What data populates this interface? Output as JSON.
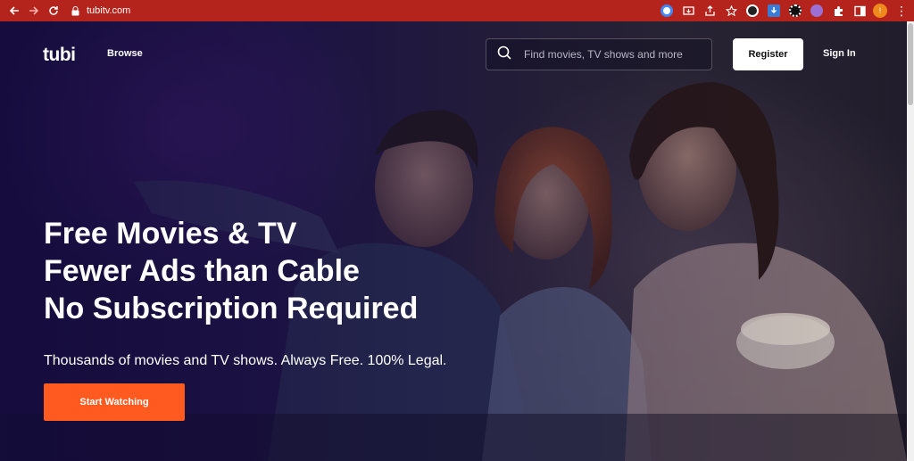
{
  "browser": {
    "url": "tubitv.com",
    "profile_initial": "!"
  },
  "header": {
    "logo": "tubi",
    "browse_label": "Browse",
    "search_placeholder": "Find movies, TV shows and more",
    "register_label": "Register",
    "signin_label": "Sign In"
  },
  "hero": {
    "headline_lines": [
      "Free Movies & TV",
      "Fewer Ads than Cable",
      "No Subscription Required"
    ],
    "tagline": "Thousands of movies and TV shows. Always Free. 100% Legal.",
    "cta_label": "Start Watching"
  },
  "colors": {
    "browser_bar": "#b4231c",
    "cta": "#ff5a1f",
    "register_bg": "#ffffff"
  }
}
